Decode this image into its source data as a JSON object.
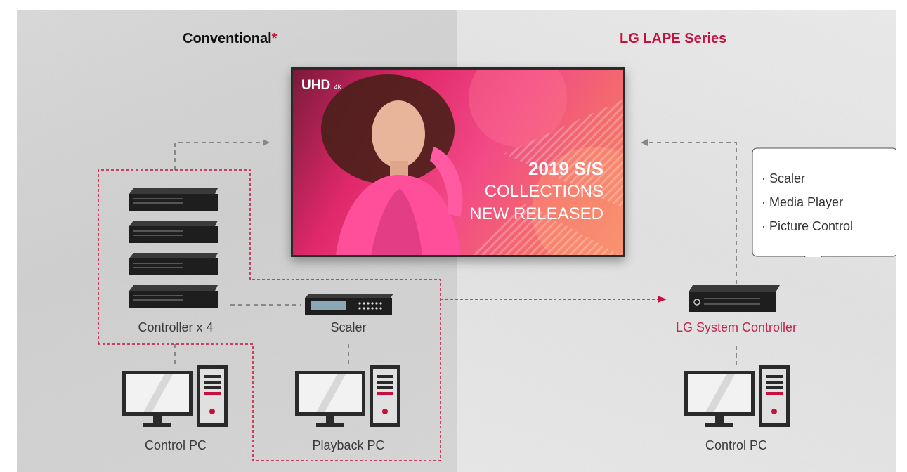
{
  "left_panel": {
    "title": "Conventional",
    "title_mark": "*"
  },
  "right_panel": {
    "title": "LG LAPE Series"
  },
  "display": {
    "badge": "UHD",
    "badge_sub": "4K",
    "headline": "2019 S/S",
    "line2": "COLLECTIONS",
    "line3": "NEW RELEASED"
  },
  "conventional": {
    "controller_label": "Controller x 4",
    "scaler_label": "Scaler",
    "control_pc_label": "Control PC",
    "playback_pc_label": "Playback PC"
  },
  "lape": {
    "system_controller_label": "LG System Controller",
    "control_pc_label": "Control PC",
    "features": [
      "· Scaler",
      "· Media Player",
      "· Picture Control"
    ]
  },
  "colors": {
    "accent": "#c8103e",
    "lg_red": "#c0254f",
    "dashed_gray": "#888888"
  }
}
